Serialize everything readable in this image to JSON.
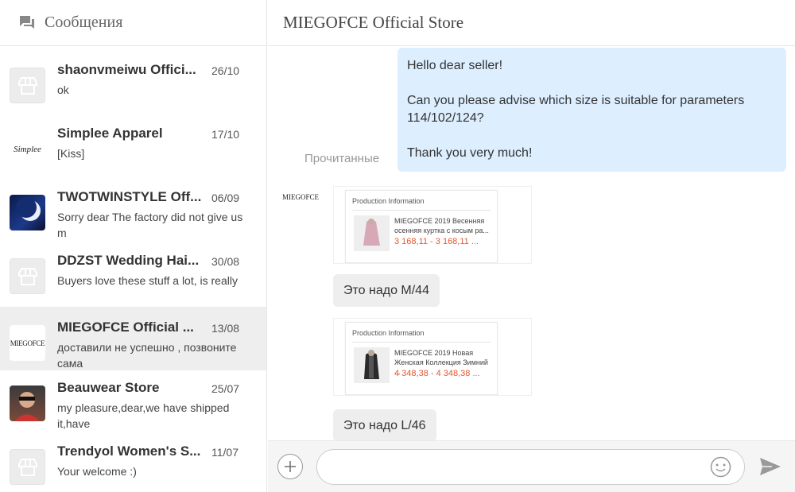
{
  "sidebar": {
    "title": "Сообщения",
    "conversations": [
      {
        "name": "shaonvmeiwu Offici...",
        "date": "26/10",
        "preview": "ok",
        "avatar": "store-icon"
      },
      {
        "name": "Simplee Apparel",
        "date": "17/10",
        "preview": "[Kiss]",
        "avatar_text": "Simplee"
      },
      {
        "name": "TWOTWINSTYLE Off...",
        "date": "06/09",
        "preview": "Sorry dear The factory did not give us m",
        "avatar": "moon-photo"
      },
      {
        "name": "DDZST Wedding Hai...",
        "date": "30/08",
        "preview": "Buyers love these stuff a lot, is really",
        "avatar": "store-icon"
      },
      {
        "name": "MIEGOFCE Official ...",
        "date": "13/08",
        "preview": "доставили не успешно , позвоните сама",
        "avatar_text": "MIEGOFCE",
        "active": true
      },
      {
        "name": "Beauwear Store",
        "date": "25/07",
        "preview": "my pleasure,dear,we have shipped it,have",
        "avatar": "person-photo"
      },
      {
        "name": "Trendyol Women's S...",
        "date": "11/07",
        "preview": "Your welcome :)",
        "avatar": "store-icon"
      }
    ]
  },
  "chat": {
    "title": "MIEGOFCE Official Store",
    "outgoing": {
      "line1": "Hello dear seller!",
      "line2": "Can you please advise which size is suitable for parameters 114/102/124?",
      "line3": "Thank you very much!"
    },
    "read_status": "Прочитанные",
    "seller_logo": "MIEGOFCE",
    "products": [
      {
        "header": "Production Information",
        "name": "MIEGOFCE 2019 Весенняя осенняя куртка с косым ра...",
        "price": "3 168,11 - 3 168,11 ..."
      },
      {
        "header": "Production Information",
        "name": "MIEGOFCE 2019 Новая Женская Коллекция Зимний ...",
        "price": "4 348,38 - 4 348,38 ..."
      }
    ],
    "replies": [
      "Это надо M/44",
      "Это надо L/46"
    ]
  },
  "input": {
    "placeholder": "",
    "value": ""
  },
  "colors": {
    "outgoing_bubble": "#ddeeff",
    "incoming_bubble": "#eeeeee",
    "price": "#e8542e",
    "active_row": "#eeeeee"
  }
}
